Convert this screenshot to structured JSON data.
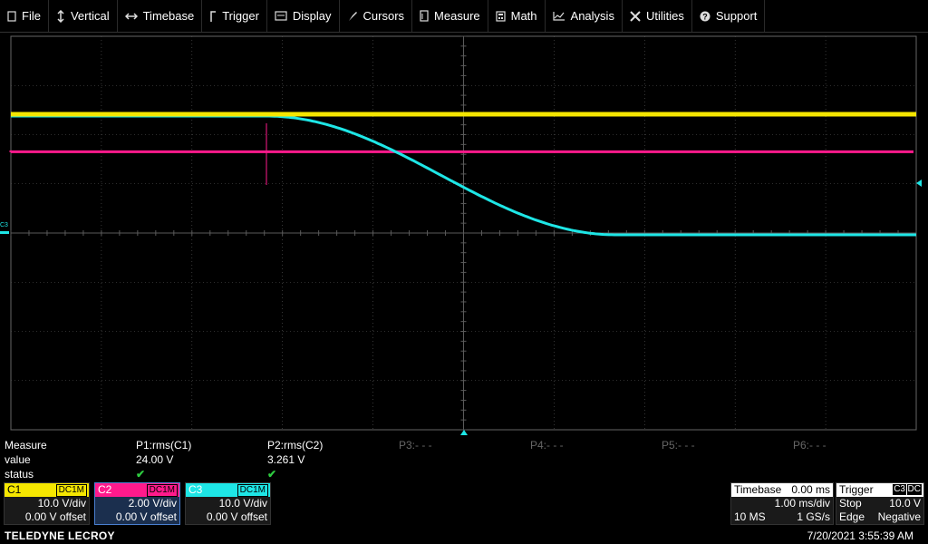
{
  "menu": [
    {
      "label": "File",
      "icon": "file-icon"
    },
    {
      "label": "Vertical",
      "icon": "vertical-arrows-icon"
    },
    {
      "label": "Timebase",
      "icon": "horizontal-arrows-icon"
    },
    {
      "label": "Trigger",
      "icon": "trigger-icon"
    },
    {
      "label": "Display",
      "icon": "display-icon"
    },
    {
      "label": "Cursors",
      "icon": "cursor-icon"
    },
    {
      "label": "Measure",
      "icon": "measure-icon"
    },
    {
      "label": "Math",
      "icon": "calculator-icon"
    },
    {
      "label": "Analysis",
      "icon": "analysis-icon"
    },
    {
      "label": "Utilities",
      "icon": "tools-icon"
    },
    {
      "label": "Support",
      "icon": "help-icon"
    }
  ],
  "scope": {
    "c3_marker_label": "C3",
    "colors": {
      "c1": "#f5e600",
      "c2": "#ff1a8c",
      "c3": "#1ee6e6",
      "grid": "#5a5a5a"
    }
  },
  "measure": {
    "row_labels": {
      "header": "Measure",
      "value": "value",
      "status": "status"
    },
    "params": [
      {
        "name": "P1:rms(C1)",
        "value": "24.00 V",
        "status": "✔"
      },
      {
        "name": "P2:rms(C2)",
        "value": "3.261 V",
        "status": "✔"
      },
      {
        "name": "P3:- - -",
        "value": "",
        "status": ""
      },
      {
        "name": "P4:- - -",
        "value": "",
        "status": ""
      },
      {
        "name": "P5:- - -",
        "value": "",
        "status": ""
      },
      {
        "name": "P6:- - -",
        "value": "",
        "status": ""
      }
    ]
  },
  "channels": [
    {
      "name": "C1",
      "coupling": "DC1M",
      "vdiv": "10.0 V/div",
      "offset": "0.00 V offset",
      "color": "#f5e600"
    },
    {
      "name": "C2",
      "coupling": "DC1M",
      "vdiv": "2.00 V/div",
      "offset": "0.00 V offset",
      "color": "#ff1a8c"
    },
    {
      "name": "C3",
      "coupling": "DC1M",
      "vdiv": "10.0 V/div",
      "offset": "0.00 V offset",
      "color": "#1ee6e6"
    }
  ],
  "timebase": {
    "label": "Timebase",
    "delay": "0.00 ms",
    "tdiv": "1.00 ms/div",
    "samples": "10 MS",
    "rate": "1 GS/s"
  },
  "trigger": {
    "label": "Trigger",
    "source": "C3",
    "coupling": "DC",
    "mode": "Stop",
    "level": "10.0 V",
    "type": "Edge",
    "slope": "Negative"
  },
  "footer": {
    "brand": "TELEDYNE LECROY",
    "datetime": "7/20/2021 3:55:39 AM"
  }
}
